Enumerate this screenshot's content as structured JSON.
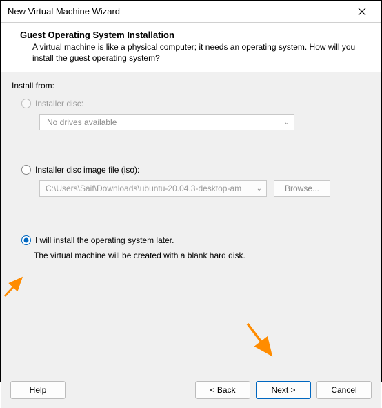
{
  "window": {
    "title": "New Virtual Machine Wizard"
  },
  "header": {
    "title": "Guest Operating System Installation",
    "description": "A virtual machine is like a physical computer; it needs an operating system. How will you install the guest operating system?"
  },
  "content": {
    "install_from_label": "Install from:",
    "option_disc": {
      "label": "Installer disc:",
      "dropdown_value": "No drives available"
    },
    "option_iso": {
      "label": "Installer disc image file (iso):",
      "path_value": "C:\\Users\\Saif\\Downloads\\ubuntu-20.04.3-desktop-am",
      "browse_label": "Browse..."
    },
    "option_later": {
      "label": "I will install the operating system later.",
      "hint": "The virtual machine will be created with a blank hard disk."
    }
  },
  "footer": {
    "help": "Help",
    "back": "< Back",
    "next": "Next >",
    "cancel": "Cancel"
  }
}
